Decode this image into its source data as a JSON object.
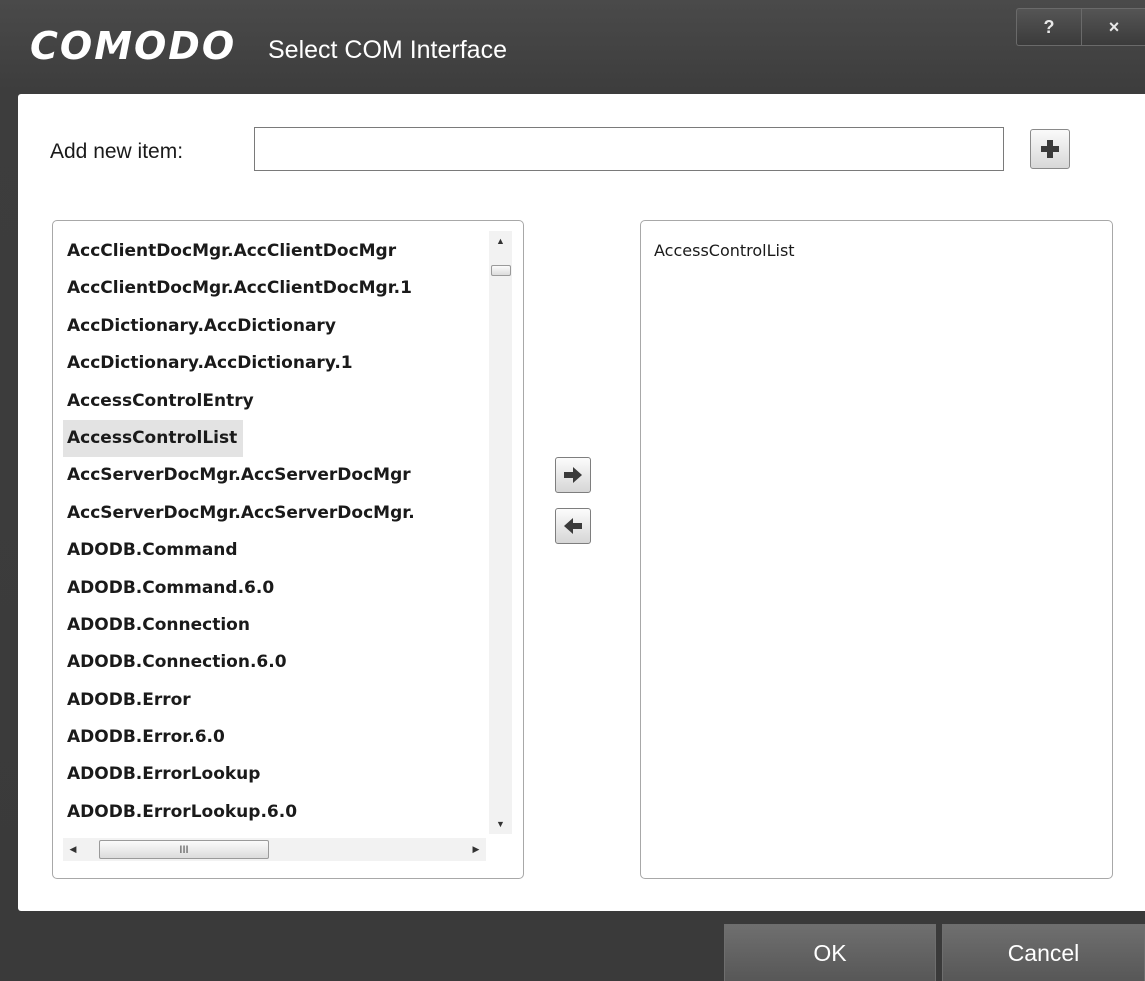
{
  "window": {
    "brand": "COMODO",
    "title": "Select COM Interface",
    "help_label": "?",
    "close_label": "×"
  },
  "add_item": {
    "label": "Add new item:",
    "value": "",
    "placeholder": ""
  },
  "available_list": {
    "items": [
      "AccClientDocMgr.AccClientDocMgr",
      "AccClientDocMgr.AccClientDocMgr.1",
      "AccDictionary.AccDictionary",
      "AccDictionary.AccDictionary.1",
      "AccessControlEntry",
      "AccessControlList",
      "AccServerDocMgr.AccServerDocMgr",
      "AccServerDocMgr.AccServerDocMgr.",
      "ADODB.Command",
      "ADODB.Command.6.0",
      "ADODB.Connection",
      "ADODB.Connection.6.0",
      "ADODB.Error",
      "ADODB.Error.6.0",
      "ADODB.ErrorLookup",
      "ADODB.ErrorLookup.6.0"
    ],
    "selected": "AccessControlList",
    "scroll_up": "▲",
    "scroll_down": "▼",
    "scroll_left": "◀",
    "scroll_right": "▶",
    "hthumb_grip": "III"
  },
  "selected_list": {
    "items": [
      "AccessControlList"
    ]
  },
  "icons": {
    "add": "plus-icon",
    "move_right": "arrow-right-icon",
    "move_left": "arrow-left-icon"
  },
  "footer": {
    "ok_label": "OK",
    "cancel_label": "Cancel"
  }
}
